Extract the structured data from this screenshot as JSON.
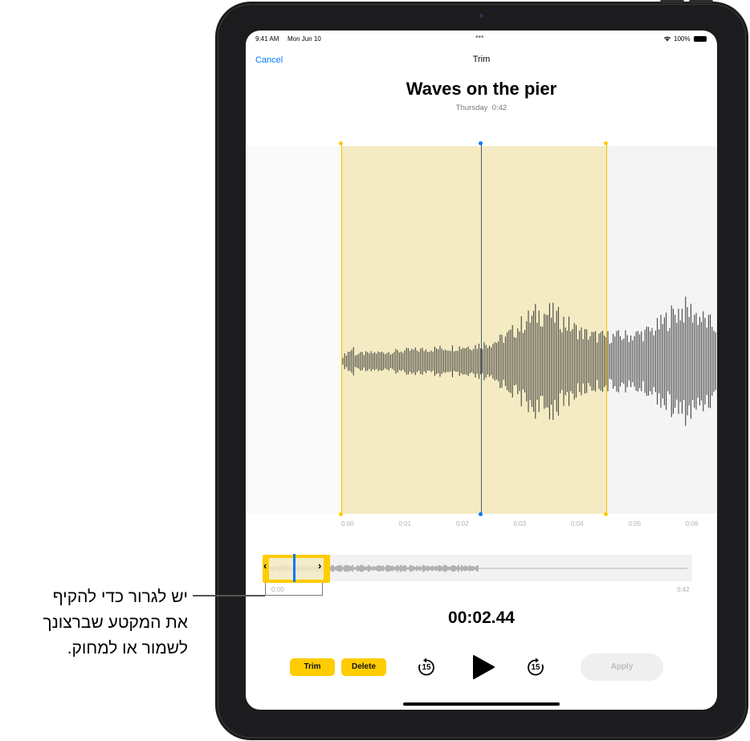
{
  "status": {
    "time": "9:41 AM",
    "date": "Mon Jun 10",
    "battery": "100%",
    "wifi_icon": "wifi-icon",
    "battery_icon": "battery-icon"
  },
  "nav": {
    "cancel": "Cancel",
    "title": "Trim"
  },
  "recording": {
    "title": "Waves on the pier",
    "day": "Thursday",
    "duration": "0:42"
  },
  "timeline": {
    "ticks": [
      "0:00",
      "0:01",
      "0:02",
      "0:03",
      "0:04",
      "0:05",
      "0:06"
    ]
  },
  "overview": {
    "start": "0:00",
    "end": "0:42"
  },
  "current_time": "00:02.44",
  "controls": {
    "trim": "Trim",
    "delete": "Delete",
    "skip_back": "15",
    "skip_forward": "15",
    "apply": "Apply"
  },
  "colors": {
    "accent": "#007aff",
    "selection": "#ffcc00",
    "selection_fill": "#f4ebc3"
  },
  "callout": {
    "lines": [
      "יש לגרור כדי להקיף",
      "את המקטע שברצונך",
      "לשמור או למחוק."
    ]
  }
}
